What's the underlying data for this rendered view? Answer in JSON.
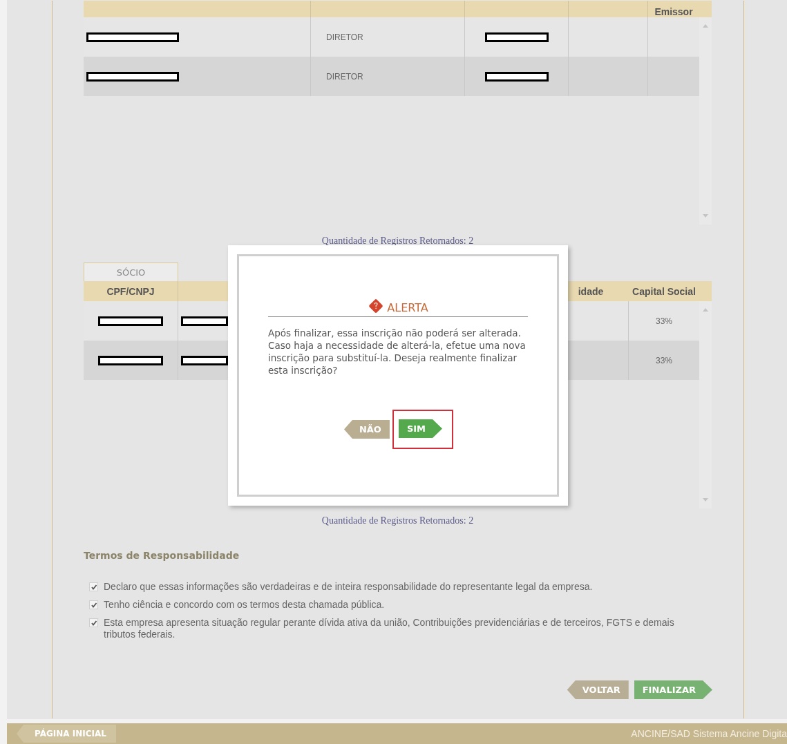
{
  "directors_table": {
    "columns": [
      {
        "kind": "cut"
      },
      {
        "kind": "cut"
      },
      {
        "kind": "cut"
      },
      {
        "kind": "cut"
      },
      {
        "kind": "label",
        "label": "Emissor"
      }
    ],
    "rows": [
      {
        "cells": [
          {
            "kind": "redacted"
          },
          {
            "kind": "text",
            "text": "DIRETOR"
          },
          {
            "kind": "redacted"
          },
          {
            "kind": "empty"
          },
          {
            "kind": "empty"
          }
        ]
      },
      {
        "cells": [
          {
            "kind": "redacted"
          },
          {
            "kind": "text",
            "text": "DIRETOR"
          },
          {
            "kind": "redacted"
          },
          {
            "kind": "empty"
          },
          {
            "kind": "empty"
          }
        ]
      }
    ],
    "count": "Quantidade de Registros Retornados: 2"
  },
  "partners_tab": {
    "label": "SÓCIO",
    "selected": true
  },
  "partners_table": {
    "columns": [
      {
        "kind": "label",
        "label": "CPF/CNPJ"
      },
      {
        "kind": "hidden"
      },
      {
        "kind": "label",
        "label": "idade"
      },
      {
        "kind": "label",
        "label": "Capital Social"
      }
    ],
    "rows": [
      {
        "cells": [
          {
            "kind": "redacted"
          },
          {
            "kind": "redacted"
          },
          {
            "kind": "empty"
          },
          {
            "kind": "text",
            "text": "33%"
          }
        ]
      },
      {
        "cells": [
          {
            "kind": "redacted"
          },
          {
            "kind": "redacted"
          },
          {
            "kind": "empty"
          },
          {
            "kind": "text",
            "text": "33%"
          }
        ]
      }
    ],
    "count": "Quantidade de Registros Retornados: 2"
  },
  "terms": {
    "title": "Termos de Responsabilidade",
    "items": [
      {
        "text": "Declaro que essas informações são verdadeiras e de inteira responsabilidade do representante legal da empresa.",
        "checked": true
      },
      {
        "text": "Tenho ciência e concordo com os termos desta chamada pública.",
        "checked": true
      },
      {
        "text": "Esta empresa apresenta situação regular perante dívida ativa da união, Contribuições previdenciárias e de terceiros, FGTS e demais tributos federais.",
        "checked": true
      }
    ]
  },
  "actions": [
    {
      "label": "VOLTAR",
      "kind": "back"
    },
    {
      "label": "FINALIZAR",
      "kind": "next"
    }
  ],
  "dialog": {
    "title": "ALERTA",
    "message": "Após finalizar, essa inscrição não poderá ser alterada. Caso haja a necessidade de alterá-la, efetue uma nova inscrição para substituí-la. Deseja realmente finalizar esta inscrição?",
    "buttons": [
      {
        "label": "NÃO",
        "kind": "back",
        "highlighted": false
      },
      {
        "label": "SIM",
        "kind": "next",
        "highlighted": true
      }
    ]
  },
  "footer": {
    "home": "PÁGINA INICIAL",
    "system": "ANCINE/SAD Sistema Ancine Digita"
  }
}
